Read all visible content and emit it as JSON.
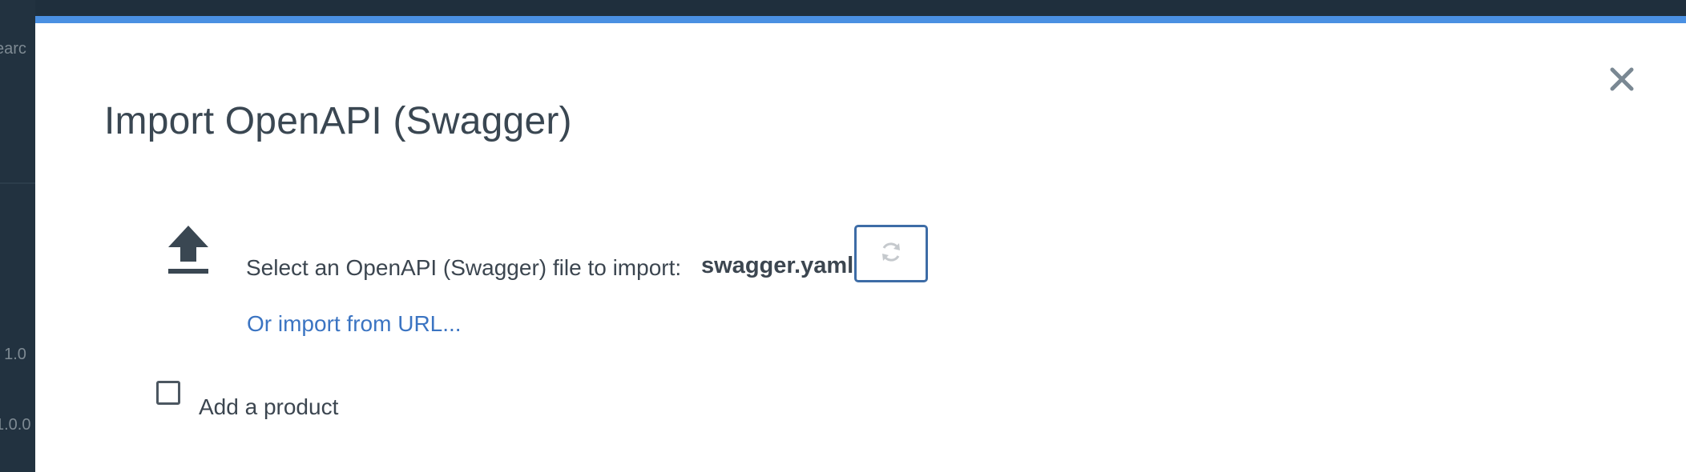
{
  "background_app": {
    "fragments": [
      "earc",
      "I 1.0",
      "1.0.0"
    ]
  },
  "modal": {
    "title": "Import OpenAPI (Swagger)",
    "close_icon": "close-icon",
    "accent_color": "#4a90e2"
  },
  "file_select": {
    "upload_icon": "upload-icon",
    "label": "Select an OpenAPI (Swagger) file to import:",
    "file_name": "swagger.yaml",
    "replace_icon": "refresh-icon",
    "url_link": "Or import from URL..."
  },
  "product": {
    "checked": false,
    "label": "Add a product"
  }
}
